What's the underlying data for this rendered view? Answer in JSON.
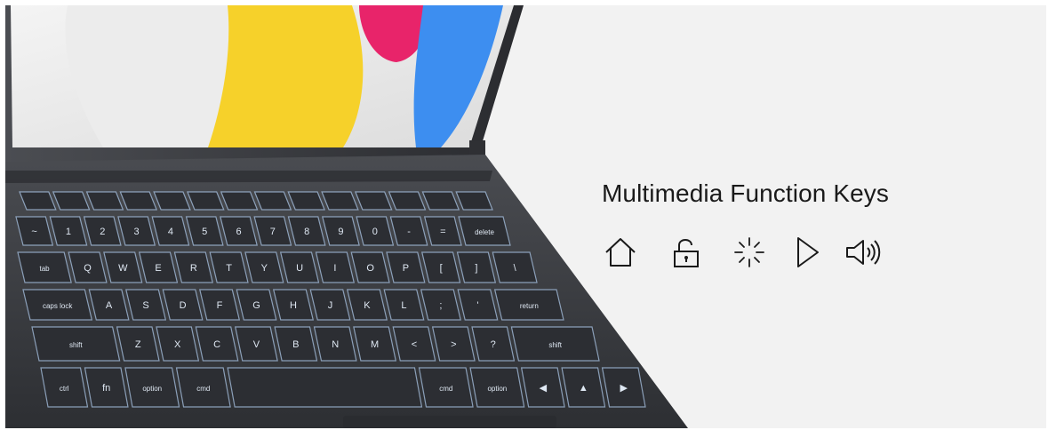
{
  "banner": {
    "title": "Multimedia Function Keys",
    "icons": [
      "home-icon",
      "lock-icon",
      "brightness-icon",
      "play-icon",
      "volume-icon"
    ],
    "colors": {
      "background": "#f2f2f2",
      "text": "#1a1a1a",
      "keyboard_body": "#3a3c41",
      "key": "#2c2e33",
      "backlight": "#a9c4e4"
    }
  },
  "keyboard": {
    "rows": [
      [
        "",
        "",
        "",
        "",
        "",
        "",
        "",
        "",
        "",
        "",
        "",
        "",
        "",
        ""
      ],
      [
        "~",
        "1",
        "2",
        "3",
        "4",
        "5",
        "6",
        "7",
        "8",
        "9",
        "0",
        "-",
        "=",
        "delete"
      ],
      [
        "tab",
        "Q",
        "W",
        "E",
        "R",
        "T",
        "Y",
        "U",
        "I",
        "O",
        "P",
        "[",
        "]",
        "\\"
      ],
      [
        "caps lock",
        "A",
        "S",
        "D",
        "F",
        "G",
        "H",
        "J",
        "K",
        "L",
        ";",
        "'",
        "return"
      ],
      [
        "shift",
        "Z",
        "X",
        "C",
        "V",
        "B",
        "N",
        "M",
        "<",
        ">",
        "?",
        "shift"
      ],
      [
        "ctrl",
        "fn",
        "option",
        "cmd",
        "",
        "cmd",
        "option",
        "◀",
        "▲",
        "▶"
      ]
    ]
  }
}
